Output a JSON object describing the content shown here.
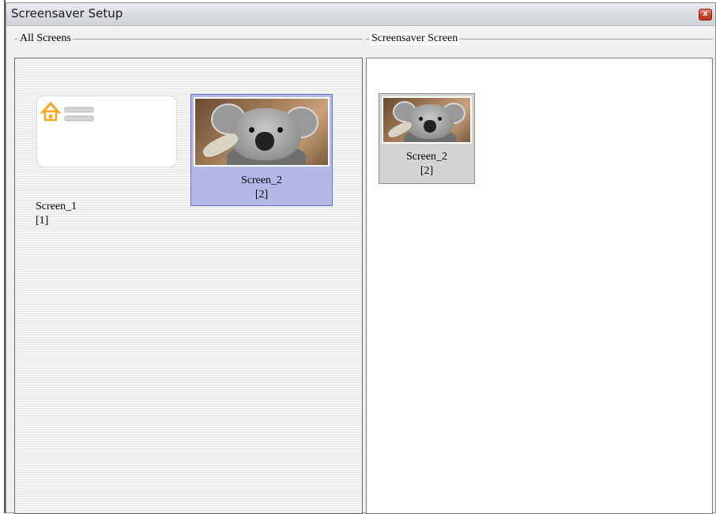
{
  "window": {
    "title": "Screensaver Setup",
    "close_glyph": "x"
  },
  "all_screens": {
    "title": "All Screens",
    "items": [
      {
        "name": "Screen_1",
        "id": "[1]",
        "thumbnail": "home-screen-icon",
        "selected": false
      },
      {
        "name": "Screen_2",
        "id": "[2]",
        "thumbnail": "koala-image",
        "selected": true
      }
    ]
  },
  "screensaver_screen": {
    "title": "Screensaver Screen",
    "items": [
      {
        "name": "Screen_2",
        "id": "[2]",
        "thumbnail": "koala-image"
      }
    ]
  },
  "colors": {
    "selection_bg": "#b4b8e6",
    "selection_border": "#6a6fd0",
    "home_icon": "#f5a623",
    "close_button": "#c9412a"
  }
}
